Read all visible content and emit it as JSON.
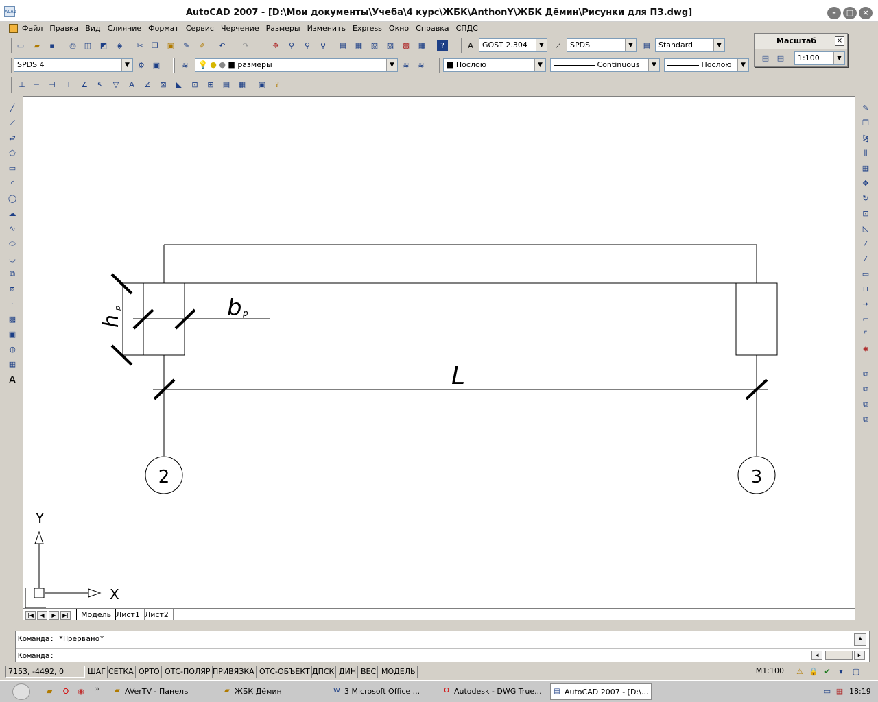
{
  "window": {
    "title": "AutoCAD 2007 - [D:\\Мои документы\\Учеба\\4 курс\\ЖБК\\AnthonY\\ЖБК Дёмин\\Рисунки для ПЗ.dwg]",
    "app_icon": "autocad-app-icon"
  },
  "menu": [
    "Файл",
    "Правка",
    "Вид",
    "Слияние",
    "Формат",
    "Сервис",
    "Черчение",
    "Размеры",
    "Изменить",
    "Express",
    "Окно",
    "Справка",
    "СПДС"
  ],
  "toolbar": {
    "text_style": "GOST 2.304",
    "dim_style": "SPDS",
    "table_style": "Standard",
    "workspace": "SPDS 4",
    "layer": "размеры",
    "color": "Послою",
    "linetype": "Continuous",
    "lineweight": "Послою"
  },
  "scale_panel": {
    "title": "Масштаб",
    "close": "×",
    "value": "1:100"
  },
  "drawing": {
    "label_h": "h",
    "label_h_sub": "р",
    "label_b": "b",
    "label_b_sub": "р",
    "label_l": "L",
    "axis_left": "2",
    "axis_right": "3",
    "ucs_x": "X",
    "ucs_y": "Y"
  },
  "tabs": [
    "Модель",
    "Лист1",
    "Лист2"
  ],
  "command": {
    "line1": "Команда: *Прервано*",
    "line2": "Команда:"
  },
  "status": {
    "coords": "7153, -4492, 0",
    "buttons": [
      "ШАГ",
      "СЕТКА",
      "ОРТО",
      "ОТС-ПОЛЯР",
      "ПРИВЯЗКА",
      "ОТС-ОБЪЕКТ",
      "ДПСК",
      "ДИН",
      "ВЕС",
      "МОДЕЛЬ"
    ],
    "scale": "M1:100"
  },
  "taskbar": {
    "items": [
      "AVerTV - Панель",
      "ЖБК Дёмин",
      "3 Microsoft Office ...",
      "Autodesk - DWG True...",
      "AutoCAD 2007 - [D:\\..."
    ],
    "clock": "18:19"
  }
}
